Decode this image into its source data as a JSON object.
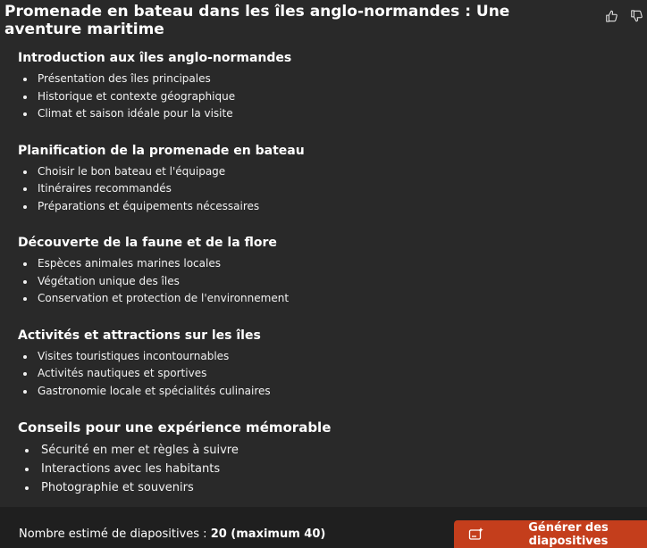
{
  "header": {
    "title": "Promenade en bateau dans les îles anglo-normandes : Une aventure maritime"
  },
  "feedback": {
    "like_icon": "thumbs-up-icon",
    "dislike_icon": "thumbs-down-icon"
  },
  "outline": {
    "sections": [
      {
        "title": "Introduction aux îles anglo-normandes",
        "items": [
          "Présentation des îles principales",
          "Historique et contexte géographique",
          "Climat et saison idéale pour la visite"
        ]
      },
      {
        "title": "Planification de la promenade en bateau",
        "items": [
          "Choisir le bon bateau et l'équipage",
          "Itinéraires recommandés",
          "Préparations et équipements nécessaires"
        ]
      },
      {
        "title": "Découverte de la faune et de la flore",
        "items": [
          "Espèces animales marines locales",
          "Végétation unique des îles",
          "Conservation et protection de l'environnement"
        ]
      },
      {
        "title": "Activités et attractions sur les îles",
        "items": [
          "Visites touristiques incontournables",
          "Activités nautiques et sportives",
          "Gastronomie locale et spécialités culinaires"
        ]
      },
      {
        "title": "Conseils pour une expérience mémorable",
        "items": [
          "Sécurité en mer et règles à suivre",
          "Interactions avec les habitants",
          "Photographie et souvenirs"
        ]
      }
    ]
  },
  "footer": {
    "estimate_label": "Nombre estimé de diapositives : ",
    "estimate_value": "20 (maximum 40)",
    "generate_label": "Générer des diapositives",
    "generate_icon": "sparkle-slides-icon",
    "button_color": "#c43e1c"
  }
}
